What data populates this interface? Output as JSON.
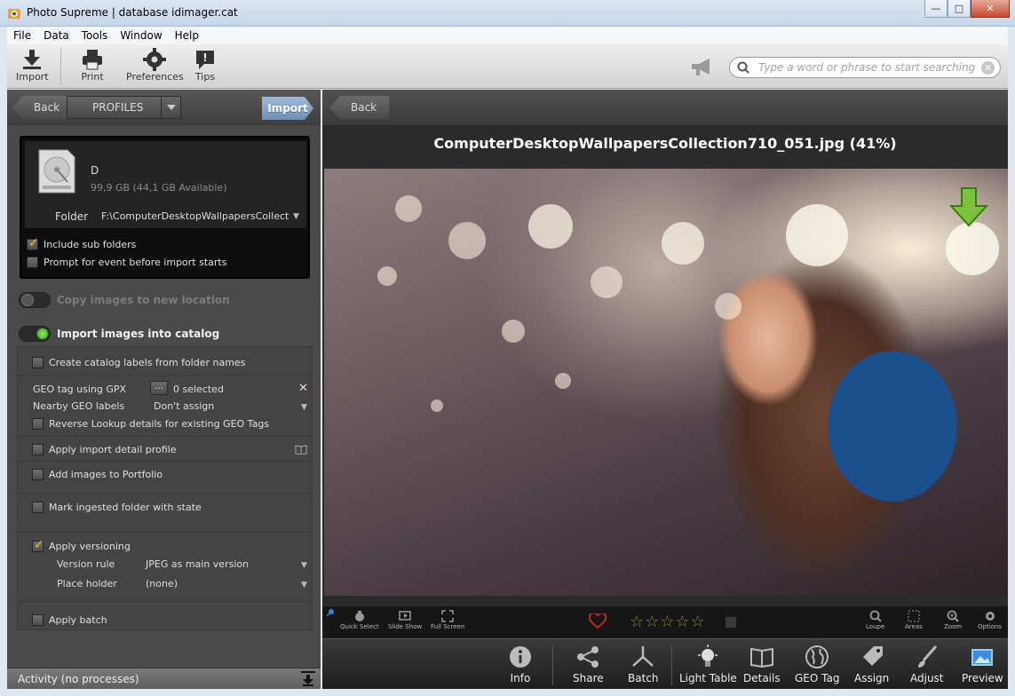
{
  "window": {
    "title": "Photo Supreme | database idimager.cat",
    "minimize": "—",
    "maximize": "□",
    "close": "✕"
  },
  "menu": [
    "File",
    "Data",
    "Tools",
    "Window",
    "Help"
  ],
  "toolbar": {
    "import": "Import",
    "print": "Print",
    "preferences": "Preferences",
    "tips": "Tips",
    "search_placeholder": "Type a word or phrase to start searching"
  },
  "left_panel": {
    "back": "Back",
    "profiles": "PROFILES",
    "import": "Import",
    "source": {
      "drive_name": "D",
      "drive_size": "99,9 GB (44,1 GB Available)",
      "folder_label": "Folder",
      "folder_value": "F:\\ComputerDesktopWallpapersCollection",
      "include_sub_folders": {
        "label": "Include sub folders",
        "checked": true
      },
      "prompt_event": {
        "label": "Prompt for event before import starts",
        "checked": false
      }
    },
    "copy_toggle": {
      "label": "Copy images to new location",
      "on": false
    },
    "import_toggle": {
      "label": "Import images into catalog",
      "on": true
    },
    "options": {
      "create_labels": {
        "label": "Create catalog labels from folder names",
        "checked": false
      },
      "geo_tag_label": "GEO tag using GPX",
      "geo_tag_btn": "...",
      "geo_tag_value": "0 selected",
      "nearby_label": "Nearby GEO labels",
      "nearby_value": "Don't assign",
      "reverse_lookup": {
        "label": "Reverse Lookup details for existing GEO Tags",
        "checked": false
      },
      "apply_profile": {
        "label": "Apply import detail profile",
        "checked": false
      },
      "add_portfolio": {
        "label": "Add images to Portfolio",
        "checked": false
      },
      "mark_folder": {
        "label": "Mark ingested folder with state",
        "checked": false
      },
      "apply_versioning": {
        "label": "Apply versioning",
        "checked": true
      },
      "version_rule_label": "Version rule",
      "version_rule_value": "JPEG as main version",
      "place_holder_label": "Place holder",
      "place_holder_value": "(none)",
      "apply_batch": {
        "label": "Apply batch",
        "checked": false
      }
    },
    "activity": "Activity (no processes)"
  },
  "right_panel": {
    "back": "Back",
    "image_title": "ComputerDesktopWallpapersCollection710_051.jpg (41%)",
    "small_tools": [
      "Quick Select",
      "Slide Show",
      "Full Screen",
      "Loupe",
      "Areas",
      "Zoom",
      "Options"
    ],
    "rating": {
      "stars": 0,
      "max": 5,
      "star_glyphs": "☆☆☆☆☆"
    },
    "tabs": [
      "Info",
      "Share",
      "Batch",
      "Light Table",
      "Details",
      "GEO Tag",
      "Assign",
      "Adjust",
      "Preview"
    ]
  },
  "colors": {
    "accent_import": "#7f9ec4",
    "toggle_on": "#3aa31b",
    "check_mark": "#f5c400",
    "heart": "#c0292b"
  }
}
